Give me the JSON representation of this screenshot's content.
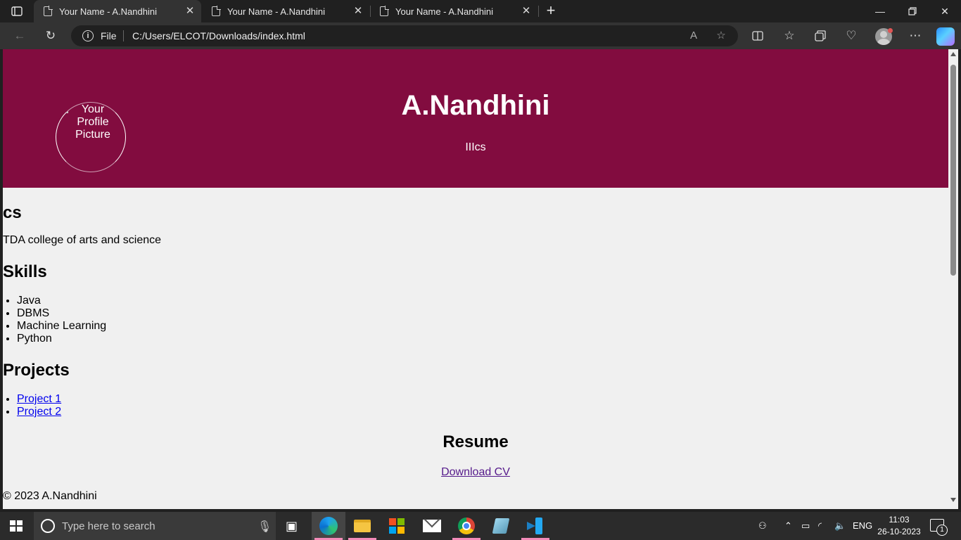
{
  "browser": {
    "tabs": [
      {
        "title": "Your Name - A.Nandhini",
        "active": true
      },
      {
        "title": "Your Name - A.Nandhini",
        "active": false
      },
      {
        "title": "Your Name - A.Nandhini",
        "active": false
      }
    ],
    "address": {
      "scheme_label": "File",
      "url": "C:/Users/ELCOT/Downloads/index.html"
    }
  },
  "page": {
    "header": {
      "profile_alt": "Your Profile Picture",
      "name": "A.Nandhini",
      "subtitle": "IIIcs"
    },
    "education": {
      "heading": "cs",
      "text": "TDA college of arts and science"
    },
    "skills": {
      "heading": "Skills",
      "items": [
        "Java",
        "DBMS",
        "Machine Learning",
        "Python"
      ]
    },
    "projects": {
      "heading": "Projects",
      "items": [
        "Project 1",
        "Project 2"
      ]
    },
    "resume": {
      "heading": "Resume",
      "link": "Download CV"
    },
    "footer": "© 2023 A.Nandhini"
  },
  "taskbar": {
    "search_placeholder": "Type here to search",
    "language": "ENG",
    "time": "11:03",
    "date": "26-10-2023",
    "notification_count": "1"
  },
  "colors": {
    "header_bg": "#820c3f",
    "page_bg": "#f0f0f0",
    "link": "#0000ee",
    "visited_link": "#551a8b"
  }
}
